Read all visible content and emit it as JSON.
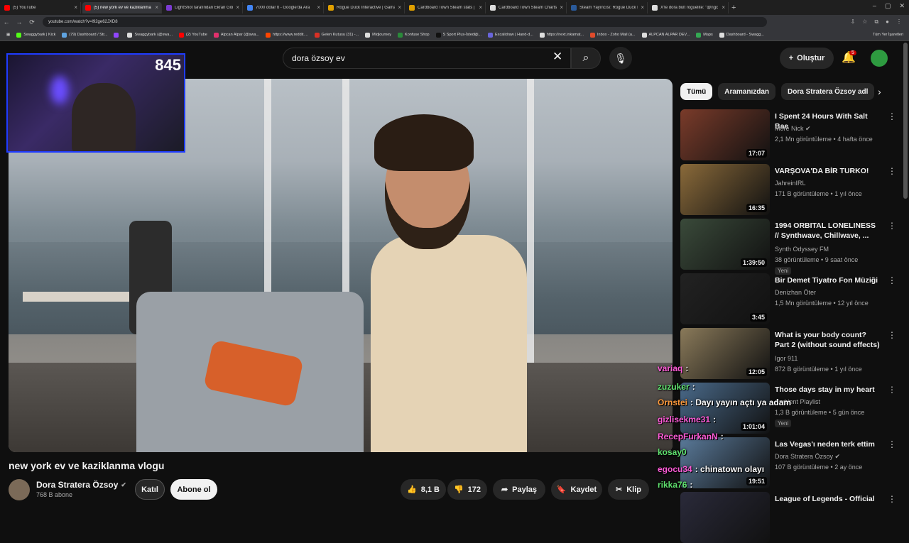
{
  "tabs": [
    {
      "label": "(5) YouTube",
      "color": "#ff0000",
      "active": false
    },
    {
      "label": "(5) new york ev ve kaziklanma",
      "color": "#ff0000",
      "active": true
    },
    {
      "label": "LightShot tarafından Ekran Görü",
      "color": "#7b3bd1",
      "active": false
    },
    {
      "label": "7000 dolar tl - Google'da Ara",
      "color": "#4285f4",
      "active": false
    },
    {
      "label": "Rogue Duck Interactive | Gama",
      "color": "#e0a000",
      "active": false
    },
    {
      "label": "Cardboard Town Steam stats |",
      "color": "#e0a000",
      "active": false
    },
    {
      "label": "Cardboard Town Steam Charts",
      "color": "#ddd",
      "active": false
    },
    {
      "label": "Steam Yayıncısı: Rogue Duck In",
      "color": "#2a5a9a",
      "active": false
    },
    {
      "label": "X'te dora bult roguelite: \"@ngc",
      "color": "#ddd",
      "active": false
    }
  ],
  "address": {
    "url": "youtube.com/watch?v=l92ge62JXD8"
  },
  "bookmarks": [
    {
      "label": "Swaggybark | Kick",
      "color": "#53fc18"
    },
    {
      "label": "(79) Dashboard / Str...",
      "color": "#5fa3e0"
    },
    {
      "label": "",
      "color": "#9146ff"
    },
    {
      "label": "Swaggybark (@swa...",
      "color": "#ddd"
    },
    {
      "label": "(2) YouTube",
      "color": "#ff0000"
    },
    {
      "label": "Alpcan Alpar (@swa...",
      "color": "#e1306c"
    },
    {
      "label": "https://www.reddit....",
      "color": "#ff4500"
    },
    {
      "label": "Gelen Kutusu (31) -...",
      "color": "#d93025"
    },
    {
      "label": "Midjourney",
      "color": "#ddd"
    },
    {
      "label": "Konfuse Shop",
      "color": "#2a8a3a"
    },
    {
      "label": "S Sport Plus-İstediği...",
      "color": "#111"
    },
    {
      "label": "Excalidraw | Hand-d...",
      "color": "#6965db"
    },
    {
      "label": "https://next.inkamat...",
      "color": "#ddd"
    },
    {
      "label": "Inbox - Zoho Mail (a...",
      "color": "#e04b2b"
    },
    {
      "label": "ALPCAN ALPAR DEV...",
      "color": "#ddd"
    },
    {
      "label": "Maps",
      "color": "#34a853"
    },
    {
      "label": "Dashboard - Swagg...",
      "color": "#ddd"
    }
  ],
  "bookmarks_other": "Tüm Yer İşaretleri",
  "youtube": {
    "search_query": "dora özsoy ev",
    "create_label": "Oluştur",
    "notif_count": "5",
    "pip_viewers": "845"
  },
  "video": {
    "title": "new york ev ve kaziklanma vlogu",
    "channel": "Dora Stratera Özsoy",
    "subscribers": "768 B abone",
    "join_label": "Katıl",
    "subscribe_label": "Abone ol",
    "likes": "8,1 B",
    "dislikes": "172",
    "share_label": "Paylaş",
    "save_label": "Kaydet",
    "clip_label": "Klip"
  },
  "chips": [
    "Tümü",
    "Aramanızdan",
    "Dora Stratera Özsoy adl"
  ],
  "recommendations": [
    {
      "title": "I Spent 24 Hours With Salt Bae",
      "channel": "More Nick",
      "verified": true,
      "meta": "2,1 Mn görüntüleme • 4 hafta önce",
      "duration": "17:07",
      "badge": "",
      "thumb": "#7a3b2a"
    },
    {
      "title": "VARŞOVA'DA BİR TURKO!",
      "channel": "JahreinIRL",
      "verified": false,
      "meta": "171 B görüntüleme • 1 yıl önce",
      "duration": "16:35",
      "badge": "",
      "thumb": "#8a6a3a"
    },
    {
      "title": "1994 ORBITAL LONELINESS // Synthwave, Chillwave, ...",
      "channel": "Synth Odyssey FM",
      "verified": false,
      "meta": "38 görüntüleme • 9 saat önce",
      "duration": "1:39:50",
      "badge": "Yeni",
      "thumb": "#3a4a3a"
    },
    {
      "title": "Bir Demet Tiyatro Fon Müziği",
      "channel": "Denizhan Öter",
      "verified": false,
      "meta": "1,5 Mn görüntüleme • 12 yıl önce",
      "duration": "3:45",
      "badge": "",
      "thumb": "#222"
    },
    {
      "title": "What is your body count? Part 2 (without sound effects)",
      "channel": "Igor 911",
      "verified": false,
      "meta": "872 B görüntüleme • 1 yıl önce",
      "duration": "12:05",
      "badge": "",
      "thumb": "#8a7a5a"
    },
    {
      "title": "Those days stay in my heart",
      "channel": "Ambient Playlist",
      "verified": false,
      "meta": "1,3 B görüntüleme • 5 gün önce",
      "duration": "1:01:04",
      "badge": "Yeni",
      "thumb": "#4a6a8a"
    },
    {
      "title": "Las Vegas'ı neden terk ettim",
      "channel": "Dora Stratera Özsoy",
      "verified": true,
      "meta": "107 B görüntüleme • 2 ay önce",
      "duration": "19:51",
      "badge": "",
      "thumb": "#5a7a9a"
    },
    {
      "title": "League of Legends - Official",
      "channel": "",
      "verified": false,
      "meta": "",
      "duration": "",
      "badge": "",
      "thumb": "#2a2a3a"
    }
  ],
  "chat": [
    {
      "user": "variaq",
      "msg": ":",
      "color": "p"
    },
    {
      "user": "zuzuker",
      "msg": ":",
      "color": "g"
    },
    {
      "user": "Ornstei",
      "msg": ": Dayı yayın açtı ya adam",
      "color": "o"
    },
    {
      "user": "gizlisekme31",
      "msg": ":",
      "color": "p"
    },
    {
      "user": "RecepFurkanN",
      "msg": ":",
      "color": "p"
    },
    {
      "user": "kosay0",
      "msg": "",
      "color": "g"
    },
    {
      "user": "egocu34",
      "msg": ": chinatown olayı",
      "color": "p"
    },
    {
      "user": "rikka76",
      "msg": ":",
      "color": "g"
    }
  ]
}
